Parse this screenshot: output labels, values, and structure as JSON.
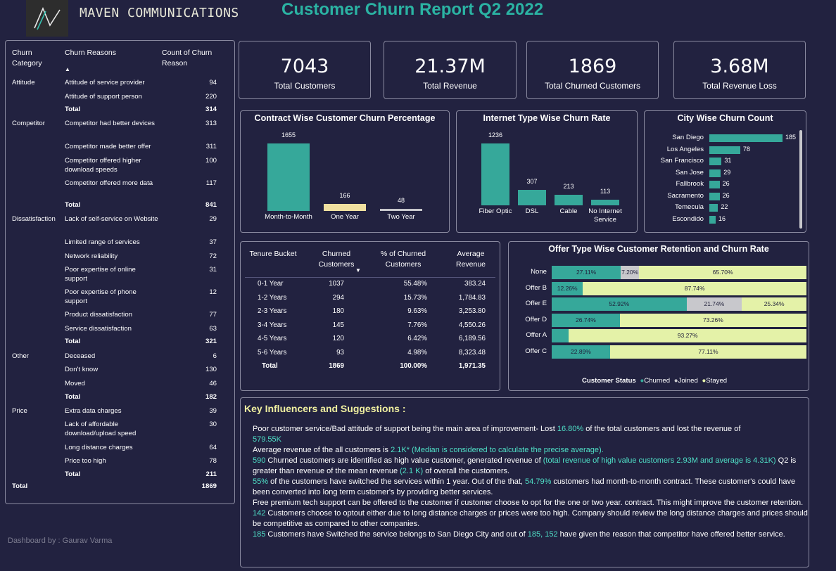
{
  "brand": "MAVEN COMMUNICATIONS",
  "report_title": "Customer Churn Report Q2 2022",
  "credit": "Dashboard by : Gaurav Varma",
  "colors": {
    "bg": "#222240",
    "teal": "#36a89a",
    "yellow": "#f0e0a0",
    "grey": "#c8c8cc",
    "lime": "#e4f2a8",
    "accent_text": "#4fe0c7"
  },
  "reasons_table": {
    "headers": {
      "category": "Churn Category",
      "reason": "Churn Reasons",
      "count": "Count of Churn Reason"
    },
    "sort_icon": "sort-ascending-icon",
    "rows": [
      {
        "cat": "Attitude",
        "reason": "Attitude of service provider",
        "count": "94"
      },
      {
        "cat": "",
        "reason": "Attitude of support person",
        "count": "220"
      },
      {
        "cat": "",
        "reason": "Total",
        "count": "314",
        "total": true
      },
      {
        "cat": "Competitor",
        "reason": "Competitor had better devices",
        "count": "313"
      },
      {
        "cat": "",
        "reason": "Competitor made better offer",
        "count": "311"
      },
      {
        "cat": "",
        "reason": "Competitor offered higher download speeds",
        "count": "100"
      },
      {
        "cat": "",
        "reason": "Competitor offered more data",
        "count": "117"
      },
      {
        "cat": "",
        "reason": "Total",
        "count": "841",
        "total": true
      },
      {
        "cat": "Dissatisfaction",
        "reason": "Lack of self-service on Website",
        "count": "29"
      },
      {
        "cat": "",
        "reason": "Limited range of services",
        "count": "37"
      },
      {
        "cat": "",
        "reason": "Network reliability",
        "count": "72"
      },
      {
        "cat": "",
        "reason": "Poor expertise of online support",
        "count": "31"
      },
      {
        "cat": "",
        "reason": "Poor expertise of phone support",
        "count": "12"
      },
      {
        "cat": "",
        "reason": "Product dissatisfaction",
        "count": "77"
      },
      {
        "cat": "",
        "reason": "Service dissatisfaction",
        "count": "63"
      },
      {
        "cat": "",
        "reason": "Total",
        "count": "321",
        "total": true
      },
      {
        "cat": "Other",
        "reason": "Deceased",
        "count": "6"
      },
      {
        "cat": "",
        "reason": "Don't know",
        "count": "130"
      },
      {
        "cat": "",
        "reason": "Moved",
        "count": "46"
      },
      {
        "cat": "",
        "reason": "Total",
        "count": "182",
        "total": true
      },
      {
        "cat": "Price",
        "reason": "Extra data charges",
        "count": "39"
      },
      {
        "cat": "",
        "reason": "Lack of affordable download/upload speed",
        "count": "30"
      },
      {
        "cat": "",
        "reason": "Long distance charges",
        "count": "64"
      },
      {
        "cat": "",
        "reason": "Price too high",
        "count": "78"
      },
      {
        "cat": "",
        "reason": "Total",
        "count": "211",
        "total": true
      }
    ],
    "grand_total_label": "Total",
    "grand_total": "1869"
  },
  "kpis": [
    {
      "value": "7043",
      "label": "Total Customers"
    },
    {
      "value": "21.37M",
      "label": "Total Revenue"
    },
    {
      "value": "1869",
      "label": "Total Churned Customers"
    },
    {
      "value": "3.68M",
      "label": "Total Revenue Loss"
    }
  ],
  "chart_data": [
    {
      "type": "bar",
      "title": "Contract Wise Customer Churn Percentage",
      "categories": [
        "Month-to-Month",
        "One Year",
        "Two Year"
      ],
      "values": [
        1655,
        166,
        48
      ],
      "colors": [
        "#36a89a",
        "#f0e0a0",
        "#c8c8cc"
      ]
    },
    {
      "type": "bar",
      "title": "Internet Type Wise Churn Rate",
      "categories": [
        "Fiber Optic",
        "DSL",
        "Cable",
        "No Internet Service"
      ],
      "values": [
        1236,
        307,
        213,
        113
      ]
    },
    {
      "type": "bar",
      "orientation": "horizontal",
      "title": "City Wise Churn Count",
      "categories": [
        "San Diego",
        "Los Angeles",
        "San Francisco",
        "San Jose",
        "Fallbrook",
        "Sacramento",
        "Temecula",
        "Escondido"
      ],
      "values": [
        185,
        78,
        31,
        29,
        26,
        26,
        22,
        16
      ]
    },
    {
      "type": "bar",
      "orientation": "horizontal",
      "stacked": true,
      "title": "Offer Type Wise Customer Retention and Churn Rate",
      "categories": [
        "None",
        "Offer B",
        "Offer E",
        "Offer D",
        "Offer A",
        "Offer C"
      ],
      "series": [
        {
          "name": "Churned",
          "values": [
            27.11,
            12.26,
            52.92,
            26.74,
            6.73,
            22.89
          ],
          "labels": [
            "27.11%",
            "12.26%",
            "52.92%",
            "26.74%",
            "",
            "22.89%"
          ]
        },
        {
          "name": "Joined",
          "values": [
            7.2,
            0,
            21.74,
            0,
            0,
            0
          ],
          "labels": [
            "7.20%",
            "",
            "21.74%",
            "",
            "",
            ""
          ]
        },
        {
          "name": "Stayed",
          "values": [
            65.7,
            87.74,
            25.34,
            73.26,
            93.27,
            77.11
          ],
          "labels": [
            "65.70%",
            "87.74%",
            "25.34%",
            "73.26%",
            "93.27%",
            "77.11%"
          ]
        }
      ],
      "legend_title": "Customer Status",
      "legend_position": "bottom"
    }
  ],
  "tenure_table": {
    "headers": [
      "Tenure Bucket",
      "Churned Customers",
      "% of Churned Customers",
      "Average Revenue"
    ],
    "sort_icon": "sort-descending-icon",
    "rows": [
      [
        "0-1 Year",
        "1037",
        "55.48%",
        "383.24"
      ],
      [
        "1-2 Years",
        "294",
        "15.73%",
        "1,784.83"
      ],
      [
        "2-3 Years",
        "180",
        "9.63%",
        "3,253.80"
      ],
      [
        "3-4 Years",
        "145",
        "7.76%",
        "4,550.26"
      ],
      [
        "4-5 Years",
        "120",
        "6.42%",
        "6,189.56"
      ],
      [
        "5-6 Years",
        "93",
        "4.98%",
        "8,323.48"
      ]
    ],
    "total": [
      "Total",
      "1869",
      "100.00%",
      "1,971.35"
    ]
  },
  "key_influencers": {
    "title": "Key Influencers and Suggestions :",
    "p1a": "Poor customer service/Bad attitude of support being the main area of improvement- Lost ",
    "p1b": "16.80%",
    "p1c": " of the total customers and lost the revenue of ",
    "p1d": "579.55K",
    "p2a": "Average revenue of the all customers is ",
    "p2b": "2.1K* (Median is considered to calculate the precise average).",
    "p3a": "590",
    "p3b": " Churned customers are identified as high value customer, generated revenue of ",
    "p3c": "(total revenue of high value customers 2.93M and average is 4.31K)",
    "p3d": "  Q2 is greater than revenue of the mean revenue ",
    "p3e": "(2.1 K)",
    "p3f": " of overall the customers.",
    "p4a": "55%",
    "p4b": " of the customers have switched the services within 1 year. Out of the that, ",
    "p4c": "54.79%",
    "p4d": " customers had month-to-month contract. These customer's could have been converted into long term customer's by providing better services.",
    "p5": "Free premium tech support can be offered to the customer if customer choose to opt for the one or two year. contract. This might  improve the customer retention.",
    "p6a": "142",
    "p6b": " Customers choose to optout either due to long distance charges or prices were too high. Company should review the long distance charges and prices should be competitive as compared to other companies.",
    "p7a": "185",
    "p7b": " Customers have Switched the service belongs to San Diego City and out of ",
    "p7c": "185, 152",
    "p7d": " have given the reason that competitor have offered better service."
  }
}
